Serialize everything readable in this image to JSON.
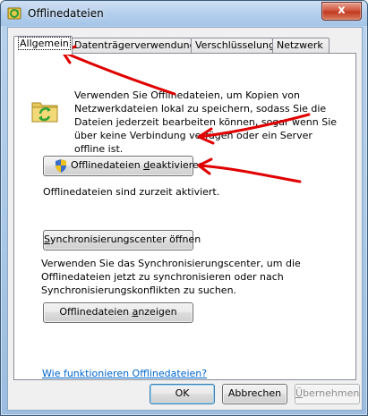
{
  "window": {
    "title": "Offlinedateien",
    "close_glyph": "x"
  },
  "tabs": [
    {
      "label": "Allgemein",
      "active": true
    },
    {
      "label": "Datenträgerverwendung",
      "active": false
    },
    {
      "label": "Verschlüsselung",
      "active": false
    },
    {
      "label": "Netzwerk",
      "active": false
    }
  ],
  "general": {
    "description": "Verwenden Sie Offlinedateien, um Kopien von Netzwerkdateien lokal zu speichern, sodass Sie die Dateien jederzeit bearbeiten können, sogar wenn Sie über keine Verbindung verfügen oder ein Server offline ist.",
    "deactivate_button": {
      "pre": "Offlinedateien ",
      "accel": "d",
      "post": "eaktivieren"
    },
    "status_text": "Offlinedateien sind zurzeit aktiviert.",
    "sync_button": {
      "accel": "S",
      "post": "ynchronisierungscenter öffnen"
    },
    "sync_description": "Verwenden Sie das Synchronisierungscenter, um die Offlinedateien jetzt zu synchronisieren oder nach Synchronisierungskonflikten zu suchen.",
    "show_button": {
      "pre": "Offlinedateien ",
      "accel": "a",
      "post": "nzeigen"
    },
    "help_link": "Wie funktionieren Offlinedateien?"
  },
  "footer": {
    "ok_label": "OK",
    "cancel_label": "Abbrechen",
    "apply_accel": "Ü",
    "apply_rest": "bernehmen",
    "apply_enabled": false
  },
  "colors": {
    "accent_link": "#0066cc",
    "annotation_arrows": "#e00000"
  },
  "icons": [
    "offline-files-app-icon",
    "close-icon",
    "sync-folder-icon",
    "uac-shield-icon"
  ]
}
